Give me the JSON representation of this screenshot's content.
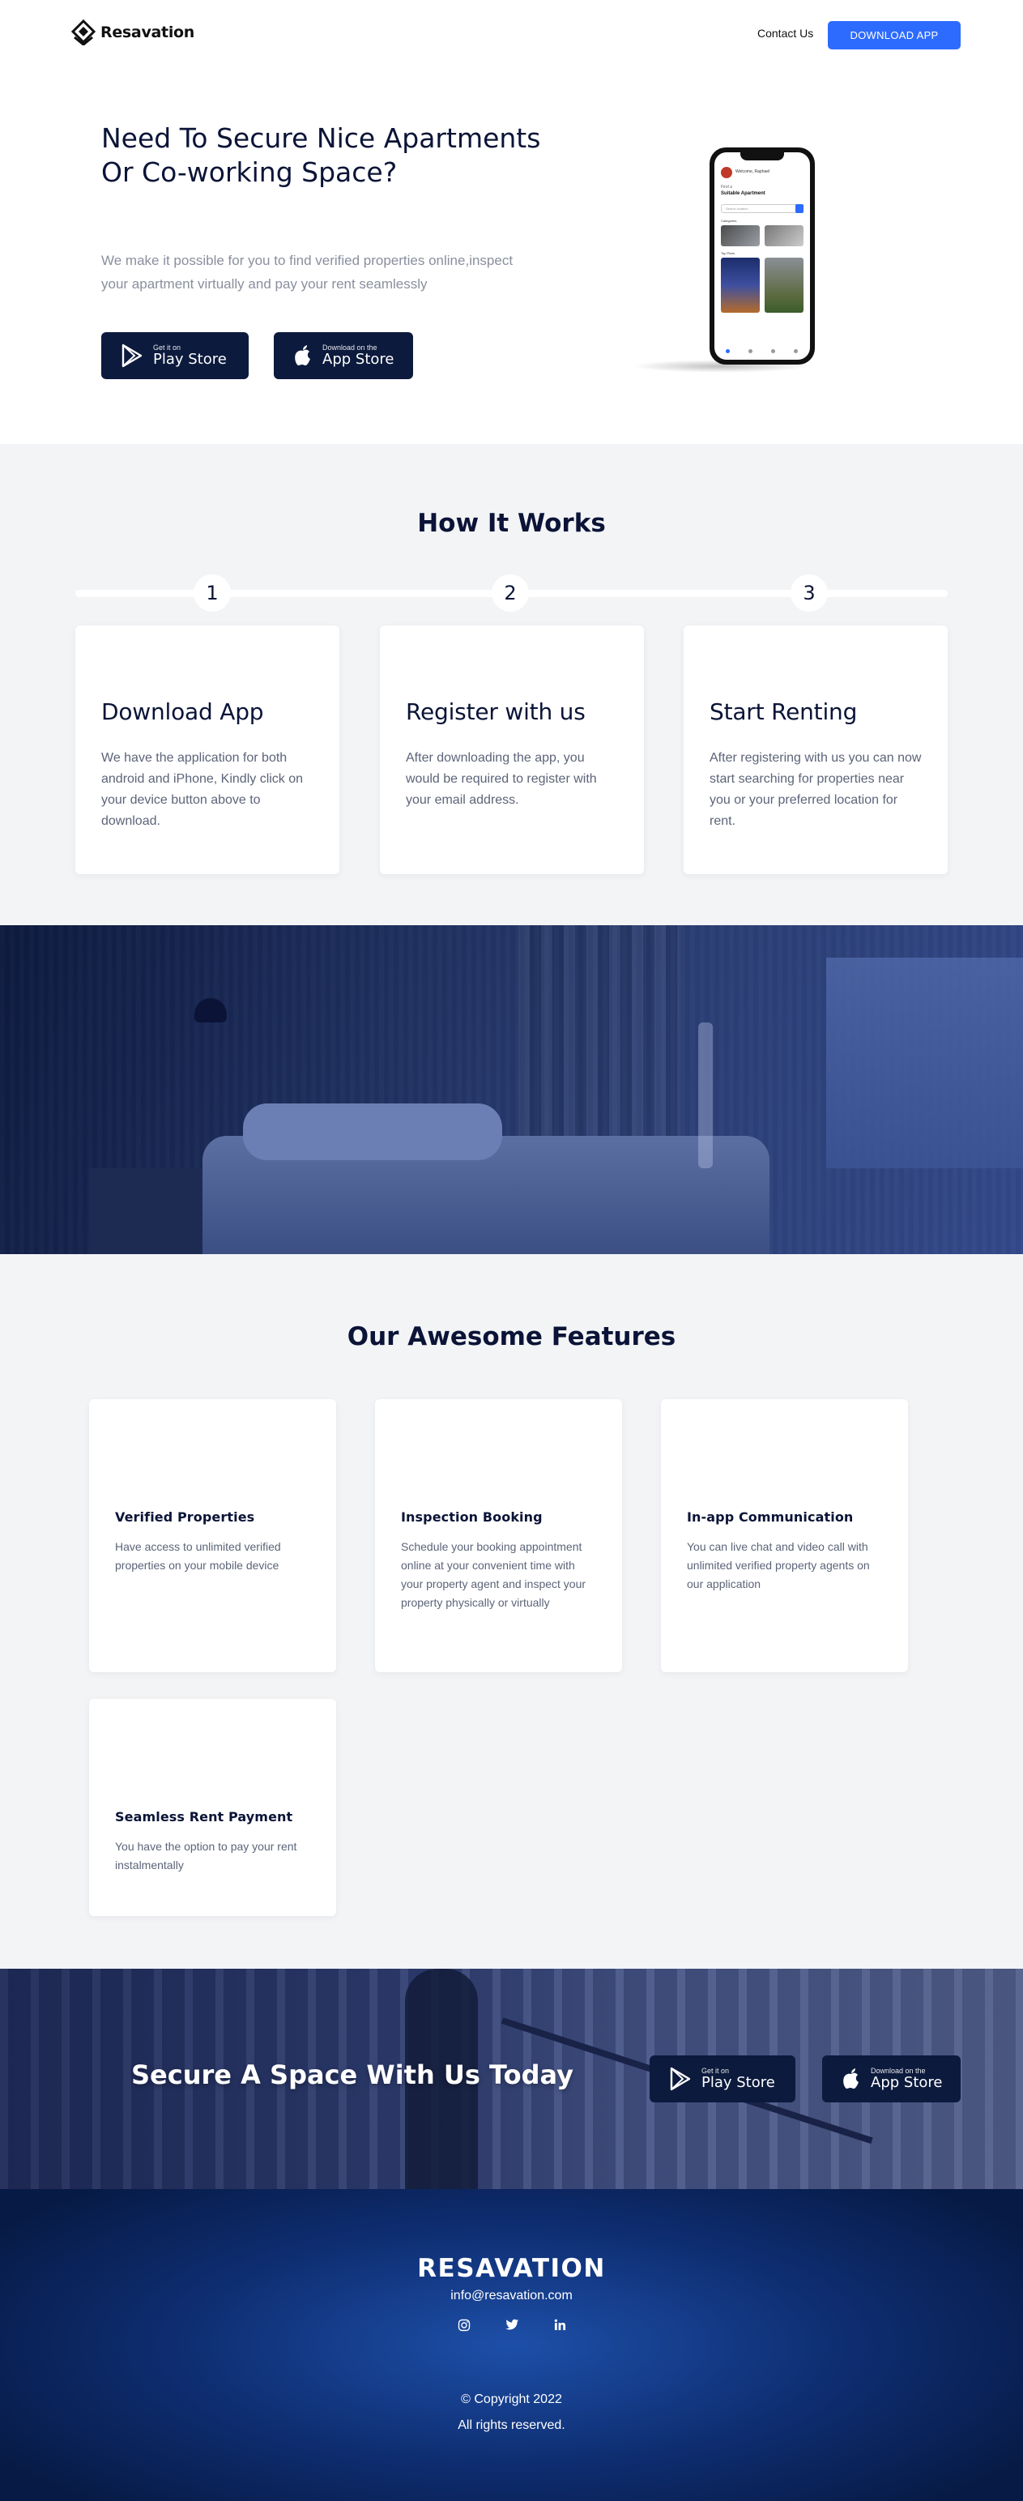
{
  "nav": {
    "brand": "Resavation",
    "contact_label": "Contact Us",
    "download_label": "DOWNLOAD APP",
    "accent_color": "#2d6bff"
  },
  "hero": {
    "title": "Need To Secure Nice Apartments Or Co-working Space?",
    "subtitle": "We make it possible for you to find verified properties online,inspect your apartment virtually and pay your rent seamlessly",
    "play_store": {
      "small": "Get it on",
      "big": "Play Store"
    },
    "app_store": {
      "small": "Download on the",
      "big": "App Store"
    },
    "phone_mockup": {
      "greeting": "Welcome, Raphael",
      "heading_small": "Find a",
      "heading": "Suitable Apartment",
      "search_placeholder": "Search location",
      "categories_label": "Categories",
      "top_picks_label": "Top Picks"
    }
  },
  "how": {
    "title": "How It Works",
    "steps": [
      {
        "num": "1",
        "title": "Download App",
        "text": "We have the application for both android and iPhone, Kindly click on your device button above to download."
      },
      {
        "num": "2",
        "title": "Register with us",
        "text": "After downloading the app, you would be required to register with your email address."
      },
      {
        "num": "3",
        "title": "Start Renting",
        "text": "After registering with us you can now start searching for properties near you or your preferred location for rent."
      }
    ]
  },
  "features": {
    "title": "Our Awesome Features",
    "items": [
      {
        "title": "Verified Properties",
        "text": "Have access to unlimited verified properties on your mobile device"
      },
      {
        "title": "Inspection Booking",
        "text": "Schedule your booking appointment online at your convenient time with your property agent and inspect your property physically or virtually"
      },
      {
        "title": "In-app Communication",
        "text": "You can live chat and video call with unlimited verified property agents on our application"
      },
      {
        "title": "Seamless Rent Payment",
        "text": "You have the option to pay your rent instalmentally"
      }
    ]
  },
  "cta": {
    "title": "Secure A Space With Us Today",
    "play_store": {
      "small": "Get it on",
      "big": "Play Store"
    },
    "app_store": {
      "small": "Download on the",
      "big": "App Store"
    }
  },
  "footer": {
    "brand": "RESAVATION",
    "email": "info@resavation.com",
    "social_icons": [
      "instagram-icon",
      "twitter-icon",
      "linkedin-icon"
    ],
    "copyright": "© Copyright 2022",
    "rights": "All rights reserved."
  }
}
